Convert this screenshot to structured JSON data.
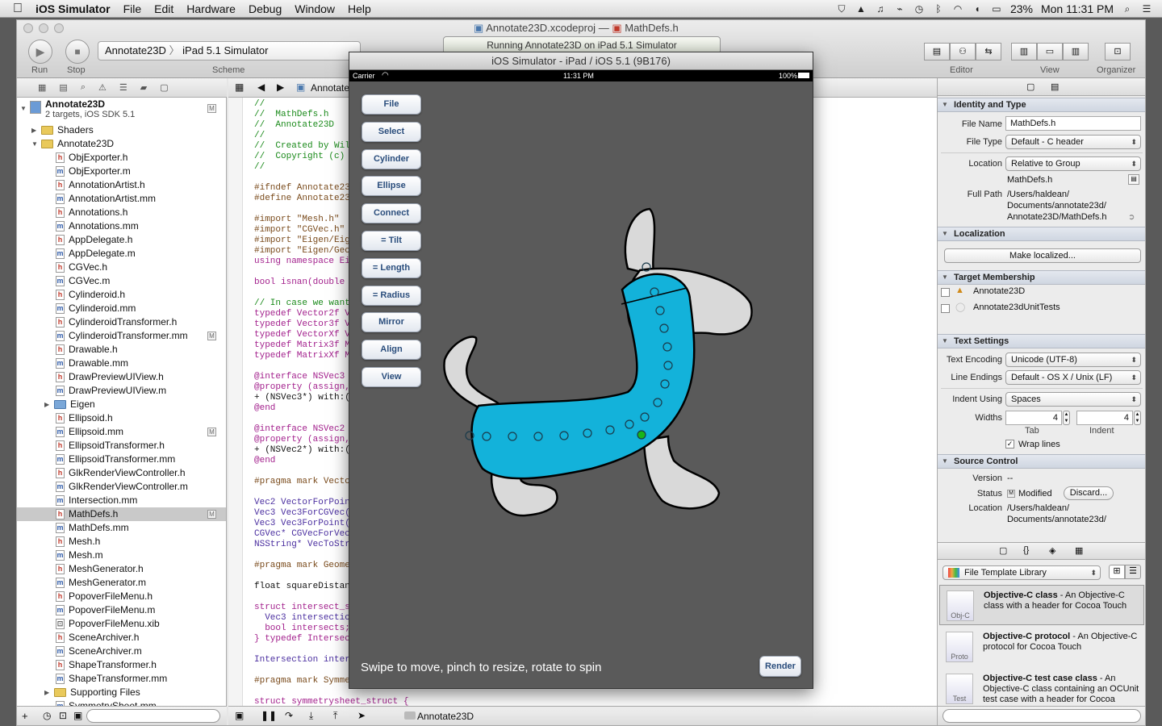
{
  "menubar": {
    "app": "iOS Simulator",
    "items": [
      "File",
      "Edit",
      "Hardware",
      "Debug",
      "Window",
      "Help"
    ],
    "battery": "23%",
    "clock": "Mon 11:31 PM"
  },
  "xcode": {
    "doc_title": "Annotate23D.xcodeproj",
    "doc_sep": "—",
    "doc_file": "MathDefs.h",
    "run": "Run",
    "stop": "Stop",
    "scheme_target": "Annotate23D",
    "scheme_device": "iPad 5.1 Simulator",
    "scheme_label": "Scheme",
    "activity": "Running Annotate23D on iPad 5.1 Simulator",
    "editor_label": "Editor",
    "view_label": "View",
    "organizer_label": "Organizer",
    "jump_item": "Annotate",
    "project_name": "Annotate23D",
    "project_sub": "2 targets, iOS SDK 5.1",
    "debug_target": "Annotate23D"
  },
  "navigator": {
    "items": [
      {
        "name": "Shaders",
        "type": "folder",
        "depth": 1,
        "closed": true
      },
      {
        "name": "Annotate23D",
        "type": "folder",
        "depth": 1,
        "open": true
      },
      {
        "name": "ObjExporter.h",
        "type": "h",
        "depth": 2
      },
      {
        "name": "ObjExporter.m",
        "type": "m",
        "depth": 2
      },
      {
        "name": "AnnotationArtist.h",
        "type": "h",
        "depth": 2
      },
      {
        "name": "AnnotationArtist.mm",
        "type": "m",
        "depth": 2
      },
      {
        "name": "Annotations.h",
        "type": "h",
        "depth": 2
      },
      {
        "name": "Annotations.mm",
        "type": "m",
        "depth": 2
      },
      {
        "name": "AppDelegate.h",
        "type": "h",
        "depth": 2
      },
      {
        "name": "AppDelegate.m",
        "type": "m",
        "depth": 2
      },
      {
        "name": "CGVec.h",
        "type": "h",
        "depth": 2
      },
      {
        "name": "CGVec.m",
        "type": "m",
        "depth": 2
      },
      {
        "name": "Cylinderoid.h",
        "type": "h",
        "depth": 2
      },
      {
        "name": "Cylinderoid.mm",
        "type": "m",
        "depth": 2
      },
      {
        "name": "CylinderoidTransformer.h",
        "type": "h",
        "depth": 2
      },
      {
        "name": "CylinderoidTransformer.mm",
        "type": "m",
        "depth": 2,
        "badge": "M"
      },
      {
        "name": "Drawable.h",
        "type": "h",
        "depth": 2
      },
      {
        "name": "Drawable.mm",
        "type": "m",
        "depth": 2
      },
      {
        "name": "DrawPreviewUIView.h",
        "type": "h",
        "depth": 2
      },
      {
        "name": "DrawPreviewUIView.m",
        "type": "m",
        "depth": 2
      },
      {
        "name": "Eigen",
        "type": "bfolder",
        "depth": 2,
        "closed": true
      },
      {
        "name": "Ellipsoid.h",
        "type": "h",
        "depth": 2
      },
      {
        "name": "Ellipsoid.mm",
        "type": "m",
        "depth": 2,
        "badge": "M"
      },
      {
        "name": "EllipsoidTransformer.h",
        "type": "h",
        "depth": 2
      },
      {
        "name": "EllipsoidTransformer.mm",
        "type": "m",
        "depth": 2
      },
      {
        "name": "GlkRenderViewController.h",
        "type": "h",
        "depth": 2
      },
      {
        "name": "GlkRenderViewController.m",
        "type": "m",
        "depth": 2
      },
      {
        "name": "Intersection.mm",
        "type": "m",
        "depth": 2
      },
      {
        "name": "MathDefs.h",
        "type": "h",
        "depth": 2,
        "badge": "M",
        "selected": true
      },
      {
        "name": "MathDefs.mm",
        "type": "m",
        "depth": 2
      },
      {
        "name": "Mesh.h",
        "type": "h",
        "depth": 2
      },
      {
        "name": "Mesh.m",
        "type": "m",
        "depth": 2
      },
      {
        "name": "MeshGenerator.h",
        "type": "h",
        "depth": 2
      },
      {
        "name": "MeshGenerator.m",
        "type": "m",
        "depth": 2
      },
      {
        "name": "PopoverFileMenu.h",
        "type": "h",
        "depth": 2
      },
      {
        "name": "PopoverFileMenu.m",
        "type": "m",
        "depth": 2
      },
      {
        "name": "PopoverFileMenu.xib",
        "type": "x",
        "depth": 2
      },
      {
        "name": "SceneArchiver.h",
        "type": "h",
        "depth": 2
      },
      {
        "name": "SceneArchiver.m",
        "type": "m",
        "depth": 2
      },
      {
        "name": "ShapeTransformer.h",
        "type": "h",
        "depth": 2
      },
      {
        "name": "ShapeTransformer.mm",
        "type": "m",
        "depth": 2
      },
      {
        "name": "Supporting Files",
        "type": "folder",
        "depth": 2,
        "closed": true
      },
      {
        "name": "SymmetrySheet.mm",
        "type": "m",
        "depth": 2
      }
    ]
  },
  "code": [
    {
      "t": "//",
      "c": "cm"
    },
    {
      "t": "//  MathDefs.h",
      "c": "cm"
    },
    {
      "t": "//  Annotate23D",
      "c": "cm"
    },
    {
      "t": "//",
      "c": "cm"
    },
    {
      "t": "//  Created by Wil",
      "c": "cm"
    },
    {
      "t": "//  Copyright (c)",
      "c": "cm"
    },
    {
      "t": "//",
      "c": "cm"
    },
    {
      "t": "",
      "c": ""
    },
    {
      "t": "#ifndef Annotate23",
      "c": "pp"
    },
    {
      "t": "#define Annotate23",
      "c": "pp"
    },
    {
      "t": "",
      "c": ""
    },
    {
      "t": "#import \"Mesh.h\"",
      "c": "pp"
    },
    {
      "t": "#import \"CGVec.h\"",
      "c": "pp"
    },
    {
      "t": "#import \"Eigen/Eig",
      "c": "pp"
    },
    {
      "t": "#import \"Eigen/Geo",
      "c": "pp"
    },
    {
      "t": "using namespace Ei",
      "c": "kw"
    },
    {
      "t": "",
      "c": ""
    },
    {
      "t": "bool isnan(double",
      "c": "kw"
    },
    {
      "t": "",
      "c": ""
    },
    {
      "t": "// In case we want",
      "c": "cm"
    },
    {
      "t": "typedef Vector2f V",
      "c": "kw"
    },
    {
      "t": "typedef Vector3f V",
      "c": "kw"
    },
    {
      "t": "typedef VectorXf V",
      "c": "kw"
    },
    {
      "t": "typedef Matrix3f M",
      "c": "kw"
    },
    {
      "t": "typedef MatrixXf M",
      "c": "kw"
    },
    {
      "t": "",
      "c": ""
    },
    {
      "t": "@interface NSVec3",
      "c": "kw"
    },
    {
      "t": "@property (assign,",
      "c": "kw"
    },
    {
      "t": "+ (NSVec3*) with:(",
      "c": "pl"
    },
    {
      "t": "@end",
      "c": "kw"
    },
    {
      "t": "",
      "c": ""
    },
    {
      "t": "@interface NSVec2",
      "c": "kw"
    },
    {
      "t": "@property (assign,",
      "c": "kw"
    },
    {
      "t": "+ (NSVec2*) with:(",
      "c": "pl"
    },
    {
      "t": "@end",
      "c": "kw"
    },
    {
      "t": "",
      "c": ""
    },
    {
      "t": "#pragma mark Vecto",
      "c": "pp"
    },
    {
      "t": "",
      "c": ""
    },
    {
      "t": "Vec2 VectorForPoin",
      "c": "ty"
    },
    {
      "t": "Vec3 Vec3ForCGVec(",
      "c": "ty"
    },
    {
      "t": "Vec3 Vec3ForPoint(",
      "c": "ty"
    },
    {
      "t": "CGVec* CGVecForVec",
      "c": "ty"
    },
    {
      "t": "NSString* VecToStr",
      "c": "ty"
    },
    {
      "t": "",
      "c": ""
    },
    {
      "t": "#pragma mark Geome",
      "c": "pp"
    },
    {
      "t": "",
      "c": ""
    },
    {
      "t": "float squareDistan",
      "c": "pl"
    },
    {
      "t": "",
      "c": ""
    },
    {
      "t": "struct intersect_s",
      "c": "kw"
    },
    {
      "t": "  Vec3 intersectio",
      "c": "ty"
    },
    {
      "t": "  bool intersects;",
      "c": "kw"
    },
    {
      "t": "} typedef Intersec",
      "c": "kw"
    },
    {
      "t": "",
      "c": ""
    },
    {
      "t": "Intersection inter",
      "c": "ty"
    },
    {
      "t": "",
      "c": ""
    },
    {
      "t": "#pragma mark Symme",
      "c": "pp"
    },
    {
      "t": "",
      "c": ""
    },
    {
      "t": "struct symmetrysheet_struct {",
      "c": "kw"
    }
  ],
  "inspector": {
    "identity": {
      "header": "Identity and Type",
      "file_name_label": "File Name",
      "file_name": "MathDefs.h",
      "file_type_label": "File Type",
      "file_type": "Default - C header",
      "location_label": "Location",
      "location": "Relative to Group",
      "loc_file": "MathDefs.h",
      "full_path_label": "Full Path",
      "full_path": [
        "/Users/haldean/",
        "Documents/annotate23d/",
        "Annotate23D/MathDefs.h"
      ]
    },
    "localization": {
      "header": "Localization",
      "button": "Make localized..."
    },
    "target": {
      "header": "Target Membership",
      "items": [
        "Annotate23D",
        "Annotate23dUnitTests"
      ]
    },
    "text": {
      "header": "Text Settings",
      "encoding_label": "Text Encoding",
      "encoding": "Unicode (UTF-8)",
      "endings_label": "Line Endings",
      "endings": "Default - OS X / Unix (LF)",
      "indent_label": "Indent Using",
      "indent": "Spaces",
      "widths_label": "Widths",
      "tab": "4",
      "indent_w": "4",
      "tab_label": "Tab",
      "indent_w_label": "Indent",
      "wrap": "Wrap lines"
    },
    "source": {
      "header": "Source Control",
      "version_label": "Version",
      "version": "--",
      "status_label": "Status",
      "status_badge": "M",
      "status": "Modified",
      "discard": "Discard...",
      "location_label": "Location",
      "location": [
        "/Users/haldean/",
        "Documents/annotate23d/"
      ]
    },
    "library": {
      "select": "File Template Library",
      "templates": [
        {
          "title": "Objective-C class",
          "desc": " - An Objective-C class with a header for Cocoa Touch",
          "icon": "Obj-C"
        },
        {
          "title": "Objective-C protocol",
          "desc": " - An Objective-C protocol for Cocoa Touch",
          "icon": "Proto"
        },
        {
          "title": "Objective-C test case class",
          "desc": " - An Objective-C class containing an OCUnit test case with a header for Cocoa Touch",
          "icon": "Test"
        }
      ]
    }
  },
  "simulator": {
    "title": "iOS Simulator - iPad / iOS 5.1 (9B176)",
    "carrier": "Carrier",
    "time": "11:31 PM",
    "battery": "100%",
    "buttons": [
      "File",
      "Select",
      "Cylinder",
      "Ellipse",
      "Connect",
      "= Tilt",
      "= Length",
      "= Radius",
      "Mirror",
      "Align",
      "View"
    ],
    "hint": "Swipe to move, pinch to resize, rotate to spin",
    "render": "Render",
    "colors": {
      "body": "#13b2da",
      "shape": "#d9d9d9",
      "background": "#5a5a5a",
      "selected_point": "#19b519"
    }
  }
}
